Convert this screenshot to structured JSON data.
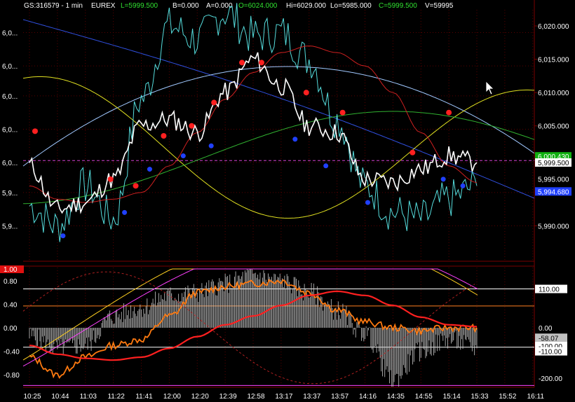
{
  "header": {
    "symbol": "GS:316579 - 1 min",
    "exchange": "EUREX",
    "last": "L=5999.500",
    "bid": "B=0.000",
    "ask": "A=0.000",
    "open": "O=6024.000",
    "high": "Hi=6029.000",
    "low": "Lo=5985.000",
    "close": "C=5999.500",
    "volume": "V=59995"
  },
  "colors": {
    "background": "#000000",
    "grid": "#7a0000",
    "price_line": "#ffffff",
    "cyan_line": "#55dddd",
    "red_avg": "#d02020",
    "yellow_curve": "#e0e020",
    "green_curve": "#30b030",
    "blue_curve": "#3050e0",
    "light_blue_curve": "#a0c8ff",
    "marker_red": "#ff2020",
    "marker_blue": "#2040ff",
    "osc_orange": "#ff7a10",
    "osc_yellow": "#ffd020",
    "osc_red": "#ff2020",
    "osc_magenta": "#ff40ff"
  },
  "chart_data": [
    {
      "type": "line",
      "x": [
        "10:25",
        "10:44",
        "11:03",
        "11:22",
        "11:41",
        "12:00",
        "12:20",
        "12:39",
        "12:58",
        "13:17",
        "13:37",
        "13:57",
        "14:16",
        "14:35",
        "14:55",
        "15:14",
        "15:33"
      ],
      "ylim": [
        5985,
        6022
      ],
      "y_ticks": [
        "6,020.000",
        "6,015.000",
        "6,010.000",
        "6,005.000",
        "5,990.000"
      ],
      "y_ticks_left": [
        "6,0...",
        "6,0...",
        "6,0...",
        "6,0...",
        "6,0...",
        "5,9...",
        "5,9..."
      ],
      "series": [
        {
          "role": "price",
          "values": [
            5999.0,
            5992.5,
            5993.5,
            5997.0,
            6005.0,
            6006.0,
            6004.0,
            6010.0,
            6015.0,
            6011.0,
            6005.0,
            6004.0,
            5997.0,
            5996.5,
            5998.5,
            6000.5,
            5999.5
          ]
        },
        {
          "role": "cyan",
          "values": [
            5993.0,
            5990.0,
            5996.0,
            5991.0,
            6009.0,
            6020.0,
            6018.0,
            6022.0,
            6018.5,
            6019.0,
            6015.0,
            6006.0,
            5996.0,
            5992.0,
            5991.0,
            5994.0,
            5996.0
          ]
        },
        {
          "role": "red_avg",
          "values": [
            5996.0,
            5994.0,
            5993.5,
            5994.0,
            5995.0,
            5999.0,
            6004.0,
            6009.0,
            6013.0,
            6016.0,
            6017.0,
            6016.0,
            6014.0,
            6010.0,
            6004.0,
            5999.0,
            5996.5
          ]
        }
      ],
      "markers": {
        "red": [
          [
            0,
            6004.2
          ],
          [
            1,
            5997.0
          ],
          [
            2,
            5996.0
          ],
          [
            3,
            6003.5
          ],
          [
            4,
            6005.0
          ],
          [
            5,
            6008.5
          ],
          [
            6,
            6014.5
          ],
          [
            7,
            6014.5
          ],
          [
            8,
            6010.0
          ],
          [
            9,
            6007.0
          ],
          [
            10,
            6001.0
          ],
          [
            11,
            6007.0
          ]
        ],
        "blue": [
          [
            0,
            5988.5
          ],
          [
            1,
            5992.0
          ],
          [
            2,
            5998.5
          ],
          [
            3,
            6000.5
          ],
          [
            4,
            6002.0
          ],
          [
            5,
            6003.0
          ],
          [
            6,
            5999.0
          ],
          [
            7,
            5993.5
          ],
          [
            8,
            5997.0
          ],
          [
            9,
            5996.0
          ]
        ]
      },
      "price_tags": [
        {
          "text": "6,000.430",
          "bg": "#10b010",
          "fg": "#ffffff",
          "value": 6000.43
        },
        {
          "text": "5,999.500",
          "bg": "#ffffff",
          "fg": "#000000",
          "value": 5999.5
        },
        {
          "text": "5,994.680",
          "bg": "#2040ff",
          "fg": "#ffffff",
          "value": 5996.0
        },
        {
          "text": "5,995.000",
          "bg": "#000000",
          "fg": "#ffffff",
          "value": 5996.2
        }
      ],
      "reference_line": 5999.8
    },
    {
      "type": "bar",
      "x": [
        "10:25",
        "10:44",
        "11:03",
        "11:22",
        "11:41",
        "12:00",
        "12:20",
        "12:39",
        "12:58",
        "13:17",
        "13:37",
        "13:57",
        "14:16",
        "14:35",
        "14:55",
        "15:14",
        "15:33"
      ],
      "ylim": [
        -1.0,
        1.0
      ],
      "y_ticks": [
        "1.00",
        "0.80",
        "0.40",
        "0.00",
        "-0.40",
        "-0.80"
      ],
      "right_labels": [
        {
          "text": "110.00",
          "bg": "#ffffff",
          "fg": "#000000"
        },
        {
          "text": "0.00",
          "bg": "#000000",
          "fg": "#ffffff"
        },
        {
          "text": "-58.07",
          "bg": "#c0c0c0",
          "fg": "#000000"
        },
        {
          "text": "-100.00",
          "bg": "#ffffff",
          "fg": "#000000"
        },
        {
          "text": "-110.00",
          "bg": "#ffffff",
          "fg": "#000000"
        },
        {
          "text": "-200.00",
          "bg": "#000000",
          "fg": "#ffffff"
        }
      ],
      "series": [
        {
          "role": "histogram",
          "values": [
            -0.15,
            -0.35,
            -0.3,
            0.2,
            0.35,
            0.55,
            0.6,
            0.75,
            0.9,
            0.8,
            0.6,
            0.3,
            -0.1,
            -0.9,
            -0.4,
            -0.2,
            -0.35
          ]
        },
        {
          "role": "orange",
          "values": [
            -0.5,
            -0.8,
            -0.5,
            -0.3,
            -0.2,
            0.2,
            0.6,
            0.7,
            0.75,
            0.8,
            0.6,
            0.3,
            0.1,
            0.0,
            -0.05,
            0.0,
            0.0
          ]
        },
        {
          "role": "red_slow",
          "values": [
            -0.3,
            -0.45,
            -0.52,
            -0.55,
            -0.5,
            -0.35,
            -0.15,
            0.05,
            0.2,
            0.38,
            0.55,
            0.62,
            0.55,
            0.38,
            0.18,
            0.05,
            0.02
          ]
        }
      ]
    }
  ],
  "x_axis_labels": [
    "10:25",
    "10:44",
    "11:03",
    "11:22",
    "11:41",
    "12:00",
    "12:20",
    "12:39",
    "12:58",
    "13:17",
    "13:37",
    "13:57",
    "14:16",
    "14:35",
    "14:55",
    "15:14",
    "15:33",
    "15:52",
    "16:11"
  ],
  "osc_top_tag": "1.00",
  "cursor_icon": "arrow-cursor-icon"
}
